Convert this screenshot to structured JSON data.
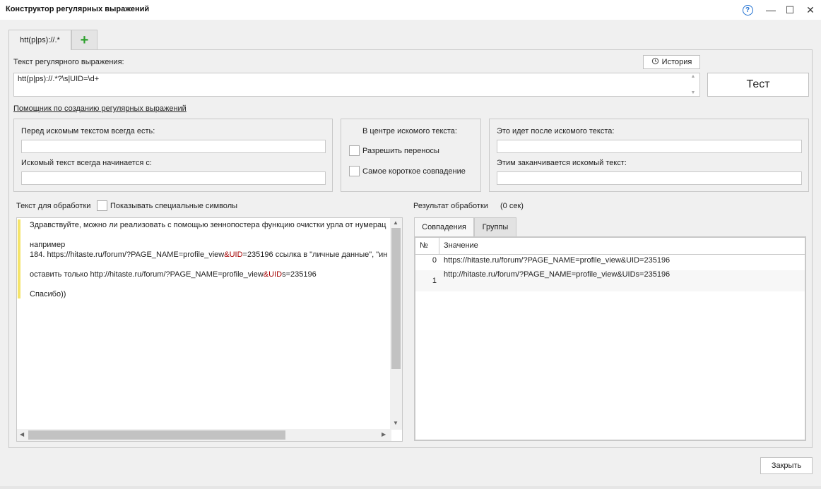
{
  "window": {
    "title": "Конструктор регулярных выражений",
    "help_glyph": "?",
    "minimize_glyph": "—",
    "maximize_glyph": "☐",
    "close_glyph": "✕"
  },
  "tabs": [
    {
      "label": "htt(p|ps)://.*"
    },
    {
      "label": "+"
    }
  ],
  "regex": {
    "label": "Текст регулярного выражения:",
    "value": "htt(p|ps)://.*?\\s|UID=\\d+",
    "history_button": "История",
    "test_button": "Тест"
  },
  "helper_link": "Помощник по созданию регулярных выражений",
  "before_group": {
    "before_label": "Перед искомым текстом всегда есть:",
    "before_value": "",
    "starts_label": "Искомый текст всегда начинается с:",
    "starts_value": ""
  },
  "center_group": {
    "title": "В центре искомого текста:",
    "allow_newlines": "Разрешить переносы",
    "shortest_match": "Самое короткое совпадение"
  },
  "after_group": {
    "after_label": "Это идет после искомого текста:",
    "after_value": "",
    "ends_label": "Этим заканчивается искомый текст:",
    "ends_value": ""
  },
  "source": {
    "label": "Текст для обработки",
    "show_special": "Показывать специальные символы",
    "line1": "Здравствуйте, можно ли реализовать с помощью зеннопостера функцию очистки урла от нумерац",
    "line3": "например",
    "line4_a": "184. https://hitaste.ru/forum/?PAGE_NAME=profile_view",
    "line4_b": "&UID",
    "line4_c": "=235196 ссылка в \"личные данные\", \"ин",
    "line6_a": "оставить только http://hitaste.ru/forum/?PAGE_NAME=profile_view",
    "line6_b": "&UID",
    "line6_c": "s=235196",
    "line8": "Спасибо))"
  },
  "result": {
    "label": "Результат обработки",
    "time": "(0 сек)",
    "tab_matches": "Совпадения",
    "tab_groups": "Группы",
    "col_num": "№",
    "col_value": "Значение",
    "rows": [
      {
        "num": "0",
        "value": "https://hitaste.ru/forum/?PAGE_NAME=profile_view&UID=235196"
      },
      {
        "num": "1",
        "value": "http://hitaste.ru/forum/?PAGE_NAME=profile_view&UIDs=235196"
      }
    ]
  },
  "close_button": "Закрыть"
}
